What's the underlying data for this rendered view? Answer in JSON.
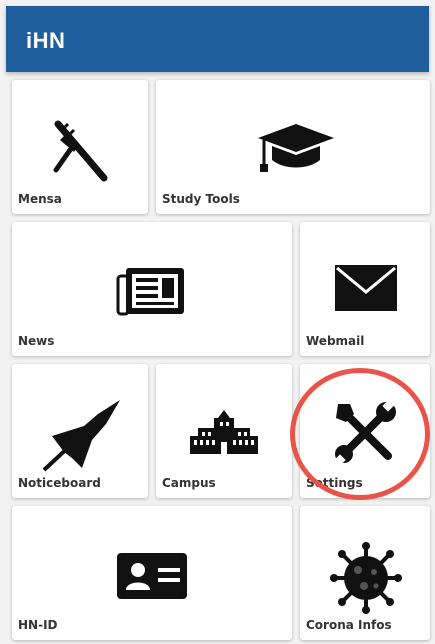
{
  "app": {
    "title": "iHN"
  },
  "tiles": [
    {
      "label": "Mensa",
      "icon": "cutlery-icon"
    },
    {
      "label": "Study Tools",
      "icon": "graduation-cap-icon"
    },
    {
      "label": "News",
      "icon": "newspaper-icon"
    },
    {
      "label": "Webmail",
      "icon": "envelope-icon"
    },
    {
      "label": "Noticeboard",
      "icon": "pushpin-icon"
    },
    {
      "label": "Campus",
      "icon": "building-icon"
    },
    {
      "label": "Settings",
      "icon": "tools-icon"
    },
    {
      "label": "HN-ID",
      "icon": "id-card-icon"
    },
    {
      "label": "Corona Infos",
      "icon": "virus-icon"
    }
  ],
  "highlight": {
    "color": "#e8534a",
    "target": "Settings"
  },
  "colors": {
    "appbar": "#1f5f9e",
    "background": "#f2f2f2"
  }
}
